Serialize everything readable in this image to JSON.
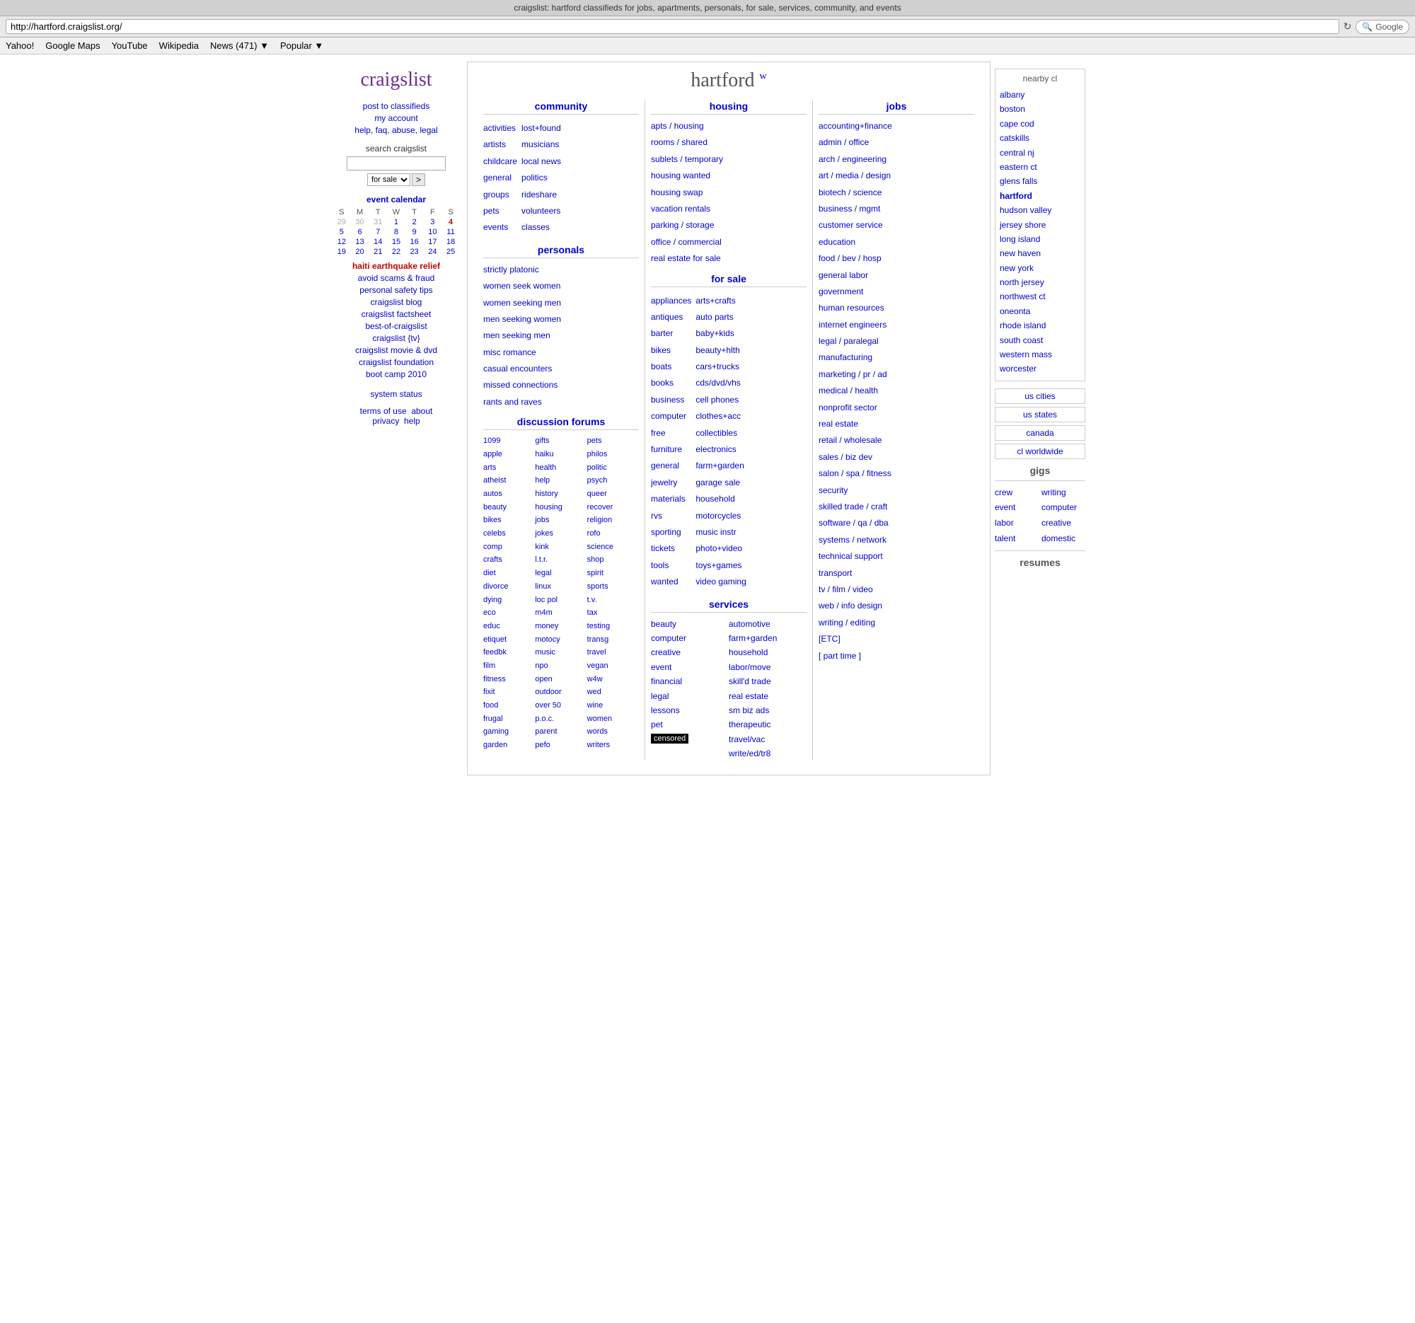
{
  "browser": {
    "title": "craigslist: hartford classifieds for jobs, apartments, personals, for sale, services, community, and events",
    "address": "http://hartford.craigslist.org/",
    "refresh_icon": "↻",
    "search_placeholder": "Google",
    "search_icon": "🔍",
    "toolbar": {
      "items": [
        "Yahoo!",
        "Google Maps",
        "YouTube",
        "Wikipedia",
        "News (471) ▼",
        "Popular ▼"
      ]
    }
  },
  "sidebar": {
    "logo": "craigslist",
    "links": [
      "post to classifieds",
      "my account",
      "help, faq, abuse, legal"
    ],
    "search_label": "search craigslist",
    "search_placeholder": "",
    "search_options": [
      "for sale"
    ],
    "search_go": ">",
    "calendar": {
      "title": "event calendar",
      "days": [
        "S",
        "M",
        "T",
        "W",
        "T",
        "F",
        "S"
      ],
      "rows": [
        [
          "29",
          "30",
          "31",
          "1",
          "2",
          "3",
          "4"
        ],
        [
          "5",
          "6",
          "7",
          "8",
          "9",
          "10",
          "11"
        ],
        [
          "12",
          "13",
          "14",
          "15",
          "16",
          "17",
          "18"
        ],
        [
          "19",
          "20",
          "21",
          "22",
          "23",
          "24",
          "25"
        ]
      ],
      "outside_days": [
        "29",
        "30",
        "31"
      ],
      "today": "4"
    },
    "special_links": [
      {
        "text": "haiti earthquake relief",
        "red": true
      },
      {
        "text": "avoid scams & fraud"
      },
      {
        "text": "personal safety tips"
      },
      {
        "text": "craigslist blog"
      },
      {
        "text": "craigslist factsheet"
      },
      {
        "text": "best-of-craigslist"
      },
      {
        "text": "craigslist {tv}"
      },
      {
        "text": "craigslist movie & dvd"
      },
      {
        "text": "craigslist foundation"
      },
      {
        "text": "boot camp 2010"
      }
    ],
    "system_status": "system status",
    "footer": [
      "terms of use",
      "about",
      "privacy",
      "help"
    ]
  },
  "main": {
    "city": "hartford",
    "city_sup": "w",
    "community": {
      "title": "community",
      "col1": [
        "activities",
        "artists",
        "childcare",
        "general",
        "groups",
        "pets",
        "events"
      ],
      "col2": [
        "lost+found",
        "musicians",
        "local news",
        "politics",
        "rideshare",
        "volunteers",
        "classes"
      ]
    },
    "personals": {
      "title": "personals",
      "items": [
        "strictly platonic",
        "women seek women",
        "women seeking men",
        "men seeking women",
        "men seeking men",
        "misc romance",
        "casual encounters",
        "missed connections",
        "rants and raves"
      ]
    },
    "discussion_forums": {
      "title": "discussion forums",
      "col1": [
        "1099",
        "apple",
        "arts",
        "atheist",
        "autos",
        "beauty",
        "bikes",
        "celebs",
        "comp",
        "crafts",
        "diet",
        "divorce",
        "dying",
        "eco",
        "educ",
        "etiquet",
        "feedbk",
        "film",
        "fitness",
        "fixit",
        "food",
        "frugal",
        "gaming",
        "garden"
      ],
      "col2": [
        "gifts",
        "haiku",
        "health",
        "help",
        "history",
        "housing",
        "jobs",
        "jokes",
        "kink",
        "l.t.r.",
        "legal",
        "linux",
        "loc pol",
        "m4m",
        "money",
        "motocy",
        "music",
        "npo",
        "open",
        "outdoor",
        "over 50",
        "p.o.c.",
        "parent",
        "pefo"
      ],
      "col3": [
        "pets",
        "philos",
        "politic",
        "psych",
        "queer",
        "recover",
        "religion",
        "rofo",
        "science",
        "shop",
        "spirit",
        "sports",
        "t.v.",
        "tax",
        "testing",
        "transg",
        "travel",
        "vegan",
        "w4w",
        "wed",
        "wine",
        "women",
        "words",
        "writers"
      ]
    },
    "housing": {
      "title": "housing",
      "items": [
        "apts / housing",
        "rooms / shared",
        "sublets / temporary",
        "housing wanted",
        "housing swap",
        "vacation rentals",
        "parking / storage",
        "office / commercial",
        "real estate for sale"
      ]
    },
    "for_sale": {
      "title": "for sale",
      "col1": [
        "appliances",
        "antiques",
        "barter",
        "bikes",
        "boats",
        "books",
        "business",
        "computer",
        "free",
        "furniture",
        "general",
        "jewelry",
        "materials",
        "rvs",
        "sporting",
        "tickets",
        "tools",
        "wanted"
      ],
      "col2": [
        "arts+crafts",
        "auto parts",
        "baby+kids",
        "beauty+hlth",
        "cars+trucks",
        "cds/dvd/vhs",
        "cell phones",
        "clothes+acc",
        "collectibles",
        "electronics",
        "farm+garden",
        "garage sale",
        "household",
        "motorcycles",
        "music instr",
        "photo+video",
        "toys+games",
        "video gaming"
      ]
    },
    "services": {
      "title": "services",
      "col1": [
        "beauty",
        "computer",
        "creative",
        "event",
        "financial",
        "legal",
        "lessons",
        "pet",
        "censored"
      ],
      "col2": [
        "automotive",
        "farm+garden",
        "household",
        "labor/move",
        "skill'd trade",
        "real estate",
        "sm biz ads",
        "therapeutic",
        "travel/vac",
        "write/ed/tr8"
      ]
    },
    "jobs": {
      "title": "jobs",
      "items": [
        "accounting+finance",
        "admin / office",
        "arch / engineering",
        "art / media / design",
        "biotech / science",
        "business / mgmt",
        "customer service",
        "education",
        "food / bev / hosp",
        "general labor",
        "government",
        "human resources",
        "internet engineers",
        "legal / paralegal",
        "manufacturing",
        "marketing / pr / ad",
        "medical / health",
        "nonprofit sector",
        "real estate",
        "retail / wholesale",
        "sales / biz dev",
        "salon / spa / fitness",
        "security",
        "skilled trade / craft",
        "software / qa / dba",
        "systems / network",
        "technical support",
        "transport",
        "tv / film / video",
        "web / info design",
        "writing / editing",
        "[ETC]",
        "[ part time ]"
      ]
    }
  },
  "right_sidebar": {
    "nearby_title": "nearby cl",
    "nearby_cities": [
      "albany",
      "boston",
      "cape cod",
      "catskills",
      "central nj",
      "eastern ct",
      "glens falls",
      "hartford",
      "hudson valley",
      "jersey shore",
      "long island",
      "new haven",
      "new york",
      "north jersey",
      "northwest ct",
      "oneonta",
      "rhode island",
      "south coast",
      "western mass",
      "worcester"
    ],
    "current_city": "hartford",
    "nav_buttons": [
      "us cities",
      "us states",
      "canada",
      "cl worldwide"
    ],
    "gigs": {
      "title": "gigs",
      "col1": [
        "crew",
        "event",
        "labor",
        "talent"
      ],
      "col2": [
        "writing",
        "computer",
        "creative",
        "domestic"
      ]
    },
    "resumes": "resumes"
  }
}
